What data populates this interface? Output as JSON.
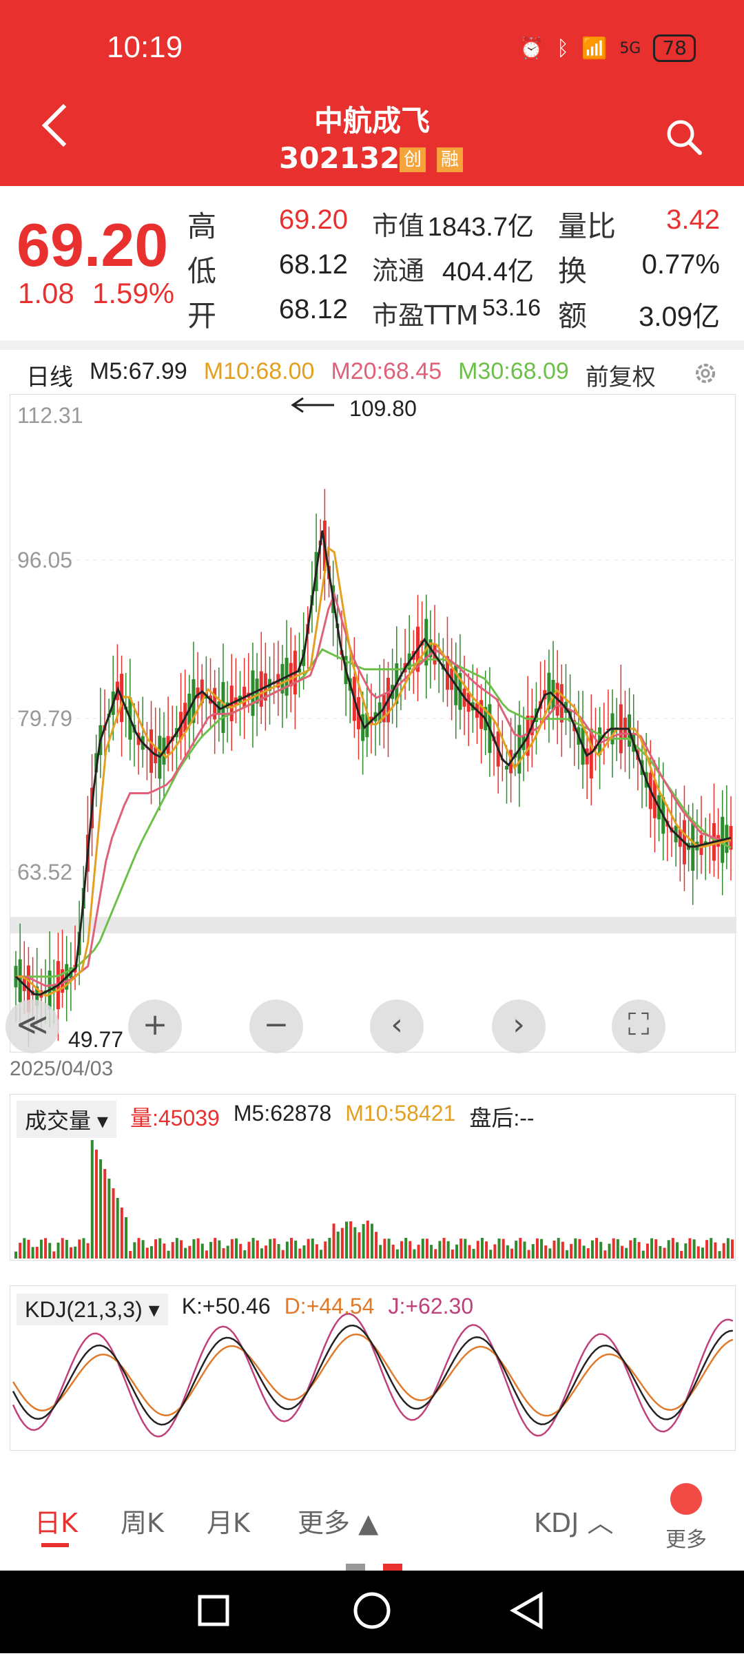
{
  "status": {
    "time": "10:19",
    "battery": "78",
    "network": "5G"
  },
  "header": {
    "title": "中航成飞",
    "code": "302132",
    "tags": [
      "创",
      "融"
    ]
  },
  "quote": {
    "price": "69.20",
    "change": "1.08",
    "change_pct": "1.59%",
    "stats": [
      {
        "label": "高",
        "value": "69.20",
        "color": "#e8312f"
      },
      {
        "label": "低",
        "value": "68.12",
        "color": "#222222"
      },
      {
        "label": "开",
        "value": "68.12",
        "color": "#222222"
      }
    ],
    "stats2": [
      {
        "label": "市值",
        "value": "1843.7亿"
      },
      {
        "label": "流通",
        "value": "404.4亿"
      },
      {
        "label": "市盈TTM",
        "value": "53.16"
      }
    ],
    "stats3": [
      {
        "label": "量比",
        "value": "3.42",
        "color": "#e8312f"
      },
      {
        "label": "换",
        "value": "0.77%",
        "color": "#222222"
      },
      {
        "label": "额",
        "value": "3.09亿",
        "color": "#222222"
      }
    ]
  },
  "ma": {
    "period": "日线",
    "m5": "M5:67.99",
    "m10": "M10:68.00",
    "m20": "M20:68.45",
    "m30": "M30:68.09",
    "adjust": "前复权",
    "colors": {
      "m5": "#222222",
      "m10": "#e3a020",
      "m20": "#e0607a",
      "m30": "#6cc04a"
    }
  },
  "kline": {
    "y_ticks": [
      "112.31",
      "96.05",
      "79.79",
      "63.52"
    ],
    "max_label": "109.80",
    "min_label": "49.77",
    "date": "2025/04/03",
    "controls": [
      "≪",
      "+",
      "−",
      "‹",
      "›",
      "⛶"
    ]
  },
  "volume": {
    "selector": "成交量",
    "vol": "量:45039",
    "m5": "M5:62878",
    "m10": "M10:58421",
    "after": "盘后:--"
  },
  "kdj": {
    "selector": "KDJ(21,3,3)",
    "k": "K:+50.46",
    "d": "D:+44.54",
    "j": "J:+62.30"
  },
  "tabs": {
    "day": "日K",
    "week": "周K",
    "month": "月K",
    "more": "更多",
    "indicator": "KDJ",
    "more2": "更多"
  },
  "chart_data": {
    "type": "line",
    "series": [
      {
        "name": "M5",
        "values": [
          55,
          53,
          54,
          56,
          78,
          84,
          79,
          77,
          80,
          84,
          82,
          83,
          84,
          85,
          86,
          100,
          87,
          80,
          82,
          86,
          89,
          86,
          83,
          81,
          76,
          79,
          84,
          82,
          77,
          80,
          80,
          74,
          70,
          68,
          68.5,
          69
        ]
      },
      {
        "name": "M30",
        "values": [
          55,
          55,
          55,
          56,
          58,
          63,
          68,
          72,
          76,
          79,
          81,
          82,
          83,
          84,
          85,
          88,
          87,
          86,
          86,
          86,
          87,
          87,
          86,
          85,
          82,
          81,
          81,
          81,
          80,
          79,
          79,
          77,
          74,
          71,
          69,
          68
        ]
      }
    ],
    "ylim": [
      49.77,
      112.31
    ]
  }
}
